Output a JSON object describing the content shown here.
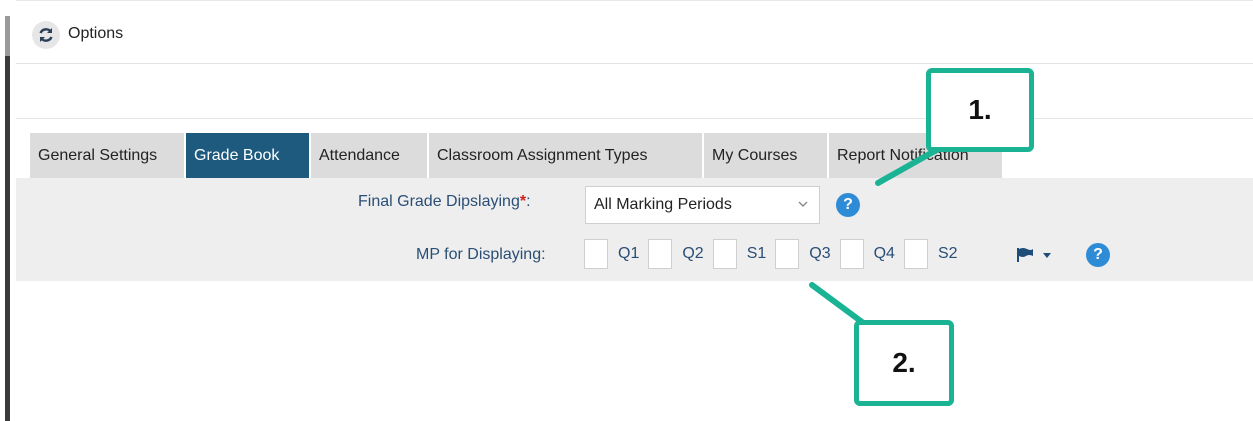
{
  "header": {
    "title": "Options"
  },
  "tabs": [
    {
      "label": "General Settings",
      "active": false
    },
    {
      "label": "Grade Book",
      "active": true
    },
    {
      "label": "Attendance",
      "active": false
    },
    {
      "label": "Classroom Assignment Types",
      "active": false
    },
    {
      "label": "My Courses",
      "active": false
    },
    {
      "label": "Report Notification",
      "active": false
    }
  ],
  "form": {
    "final_grade_label": "Final Grade Dipslaying",
    "required_mark": "*",
    "label_colon": ":",
    "final_grade_value": "All Marking Periods",
    "mp_label": "MP for Displaying:",
    "marking_periods": [
      "Q1",
      "Q2",
      "S1",
      "Q3",
      "Q4",
      "S2"
    ],
    "help_glyph": "?"
  },
  "callouts": {
    "first": "1.",
    "second": "2."
  },
  "colors": {
    "active_tab": "#1e5a7e",
    "help_icon": "#2e8bd6",
    "callout_border": "#1ab394",
    "label_text": "#2a4e76"
  }
}
